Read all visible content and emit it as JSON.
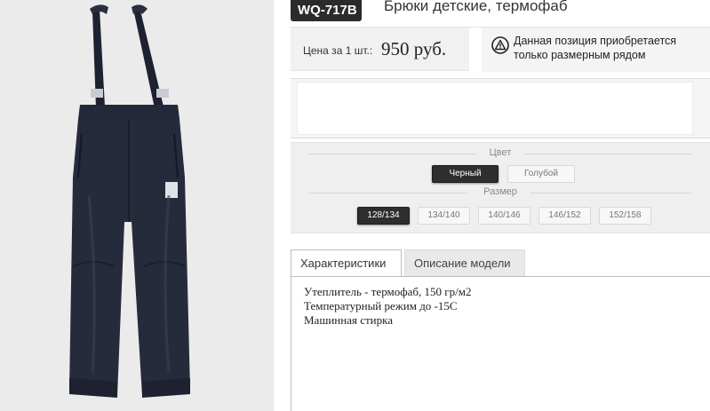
{
  "product": {
    "sku": "WQ-717B",
    "title": "Брюки детские, термофаб",
    "image_alt": "pants-image"
  },
  "price": {
    "label": "Цена за 1 шт.:",
    "value": "950 руб."
  },
  "notice": {
    "icon": "warning-icon",
    "line1": "Данная позиция приобретается",
    "line2": "только размерным рядом"
  },
  "options": {
    "color_label": "Цвет",
    "colors": [
      {
        "label": "Черный",
        "selected": true
      },
      {
        "label": "Голубой",
        "selected": false
      }
    ],
    "size_label": "Размер",
    "sizes": [
      {
        "label": "128/134",
        "selected": true
      },
      {
        "label": "134/140",
        "selected": false
      },
      {
        "label": "140/146",
        "selected": false
      },
      {
        "label": "146/152",
        "selected": false
      },
      {
        "label": "152/158",
        "selected": false
      }
    ]
  },
  "tabs": [
    {
      "label": "Характеристики",
      "active": true
    },
    {
      "label": "Описание модели",
      "active": false
    }
  ],
  "specs": [
    "Утеплитель - термофаб, 150 гр/м2",
    "Температурный режим до -15С",
    "Машинная стирка"
  ],
  "colors": {
    "badge_bg": "#2b2b2b",
    "selected_chip": "#2e2e2e",
    "image_bg": "#ebebeb"
  }
}
